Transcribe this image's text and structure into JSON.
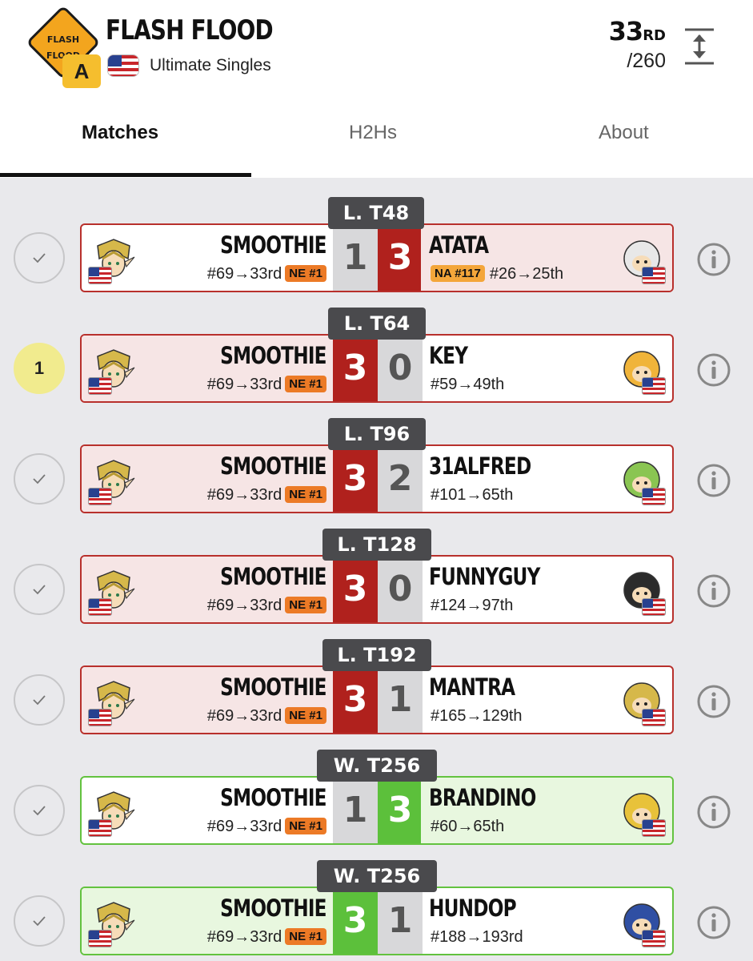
{
  "header": {
    "event_name": "FLASH FLOOD",
    "logo_text": "FLASH FLOOD",
    "tier": "A",
    "game": "Ultimate Singles",
    "placement": "33",
    "placement_suffix": "RD",
    "total": "/260"
  },
  "tabs": [
    {
      "label": "Matches",
      "active": true
    },
    {
      "label": "H2Hs",
      "active": false
    },
    {
      "label": "About",
      "active": false
    }
  ],
  "colors": {
    "loss_red": "#b0211d",
    "win_green": "#5cc03b",
    "tag_orange": "#ec7a26",
    "tier_yellow": "#f5be2e",
    "highlight_yellow": "#f1eb8e"
  },
  "matches": [
    {
      "round": "L. T48",
      "status": "✓",
      "left": {
        "name": "SMOOTHIE",
        "seed": "#69→33rd",
        "tag": "NE #1",
        "score": "1"
      },
      "right": {
        "name": "ATATA",
        "seed": "#26→25th",
        "tag": "NA #117",
        "score": "3"
      },
      "result": "loss"
    },
    {
      "round": "L. T64",
      "status": "1",
      "left": {
        "name": "SMOOTHIE",
        "seed": "#69→33rd",
        "tag": "NE #1",
        "score": "3"
      },
      "right": {
        "name": "KEY",
        "seed": "#59→49th",
        "tag": "",
        "score": "0"
      },
      "result": "win-red"
    },
    {
      "round": "L. T96",
      "status": "✓",
      "left": {
        "name": "SMOOTHIE",
        "seed": "#69→33rd",
        "tag": "NE #1",
        "score": "3"
      },
      "right": {
        "name": "31ALFRED",
        "seed": "#101→65th",
        "tag": "",
        "score": "2"
      },
      "result": "win-red"
    },
    {
      "round": "L. T128",
      "status": "✓",
      "left": {
        "name": "SMOOTHIE",
        "seed": "#69→33rd",
        "tag": "NE #1",
        "score": "3"
      },
      "right": {
        "name": "FUNNYGUY",
        "seed": "#124→97th",
        "tag": "",
        "score": "0"
      },
      "result": "win-red"
    },
    {
      "round": "L. T192",
      "status": "✓",
      "left": {
        "name": "SMOOTHIE",
        "seed": "#69→33rd",
        "tag": "NE #1",
        "score": "3"
      },
      "right": {
        "name": "MANTRA",
        "seed": "#165→129th",
        "tag": "",
        "score": "1"
      },
      "result": "win-red"
    },
    {
      "round": "W. T256",
      "status": "✓",
      "left": {
        "name": "SMOOTHIE",
        "seed": "#69→33rd",
        "tag": "NE #1",
        "score": "1"
      },
      "right": {
        "name": "BRANDINO",
        "seed": "#60→65th",
        "tag": "",
        "score": "3"
      },
      "result": "loss-green"
    },
    {
      "round": "W. T256",
      "status": "✓",
      "left": {
        "name": "SMOOTHIE",
        "seed": "#69→33rd",
        "tag": "NE #1",
        "score": "3"
      },
      "right": {
        "name": "HUNDOP",
        "seed": "#188→193rd",
        "tag": "",
        "score": "1"
      },
      "result": "win-green"
    }
  ],
  "icons": {
    "check": "checkmark-icon",
    "info": "info-icon",
    "collapse": "expand-collapse-icon",
    "flag": "us-flag-icon",
    "character": "character-icon"
  }
}
